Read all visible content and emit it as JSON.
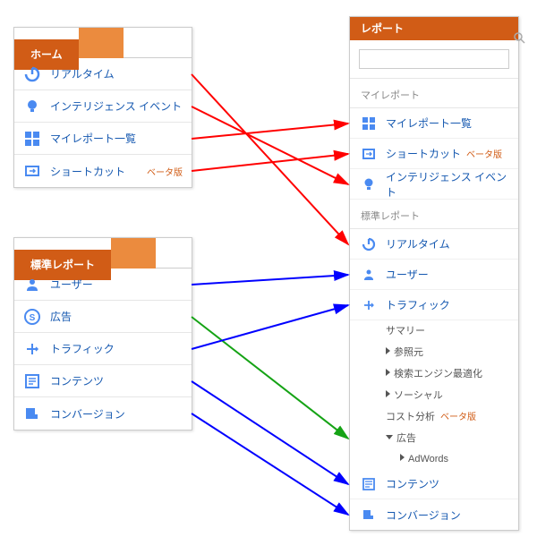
{
  "left_home": {
    "tab": "ホーム",
    "items": [
      {
        "label": "リアルタイム",
        "icon": "realtime"
      },
      {
        "label": "インテリジェンス イベント",
        "icon": "bulb"
      },
      {
        "label": "マイレポート一覧",
        "icon": "dashboard"
      },
      {
        "label": "ショートカット",
        "icon": "shortcut",
        "beta": "ベータ版"
      }
    ]
  },
  "left_std": {
    "tab": "標準レポート",
    "items": [
      {
        "label": "ユーザー",
        "icon": "user"
      },
      {
        "label": "広告",
        "icon": "ads"
      },
      {
        "label": "トラフィック",
        "icon": "traffic"
      },
      {
        "label": "コンテンツ",
        "icon": "content"
      },
      {
        "label": "コンバージョン",
        "icon": "conversion"
      }
    ]
  },
  "right": {
    "header": "レポート",
    "search_placeholder": "",
    "section_my": "マイレポート",
    "my_items": [
      {
        "label": "マイレポート一覧",
        "icon": "dashboard"
      },
      {
        "label": "ショートカット",
        "icon": "shortcut",
        "beta": "ベータ版"
      },
      {
        "label": "インテリジェンス イベント",
        "icon": "bulb"
      }
    ],
    "section_std": "標準レポート",
    "std_items": [
      {
        "label": "リアルタイム",
        "icon": "realtime"
      },
      {
        "label": "ユーザー",
        "icon": "user"
      },
      {
        "label": "トラフィック",
        "icon": "traffic",
        "sub": [
          {
            "label": "サマリー",
            "tri": false
          },
          {
            "label": "参照元",
            "tri": true
          },
          {
            "label": "検索エンジン最適化",
            "tri": true
          },
          {
            "label": "ソーシャル",
            "tri": true
          },
          {
            "label": "コスト分析",
            "tri": false,
            "beta": "ベータ版"
          },
          {
            "label": "広告",
            "tri": "down",
            "sub": [
              {
                "label": "AdWords"
              }
            ]
          }
        ]
      },
      {
        "label": "コンテンツ",
        "icon": "content"
      },
      {
        "label": "コンバージョン",
        "icon": "conversion"
      }
    ]
  },
  "arrows": [
    {
      "from": "l-home-0",
      "to": "r-std-0",
      "color": "red"
    },
    {
      "from": "l-home-1",
      "to": "r-my-2",
      "color": "red"
    },
    {
      "from": "l-home-2",
      "to": "r-my-0",
      "color": "red"
    },
    {
      "from": "l-home-3",
      "to": "r-my-1",
      "color": "red"
    },
    {
      "from": "l-std-0",
      "to": "r-std-1",
      "color": "blue"
    },
    {
      "from": "l-std-1",
      "to": "r-sub-5",
      "color": "green"
    },
    {
      "from": "l-std-2",
      "to": "r-std-2",
      "color": "blue"
    },
    {
      "from": "l-std-3",
      "to": "r-std-3",
      "color": "blue"
    },
    {
      "from": "l-std-4",
      "to": "r-std-4",
      "color": "blue"
    }
  ]
}
